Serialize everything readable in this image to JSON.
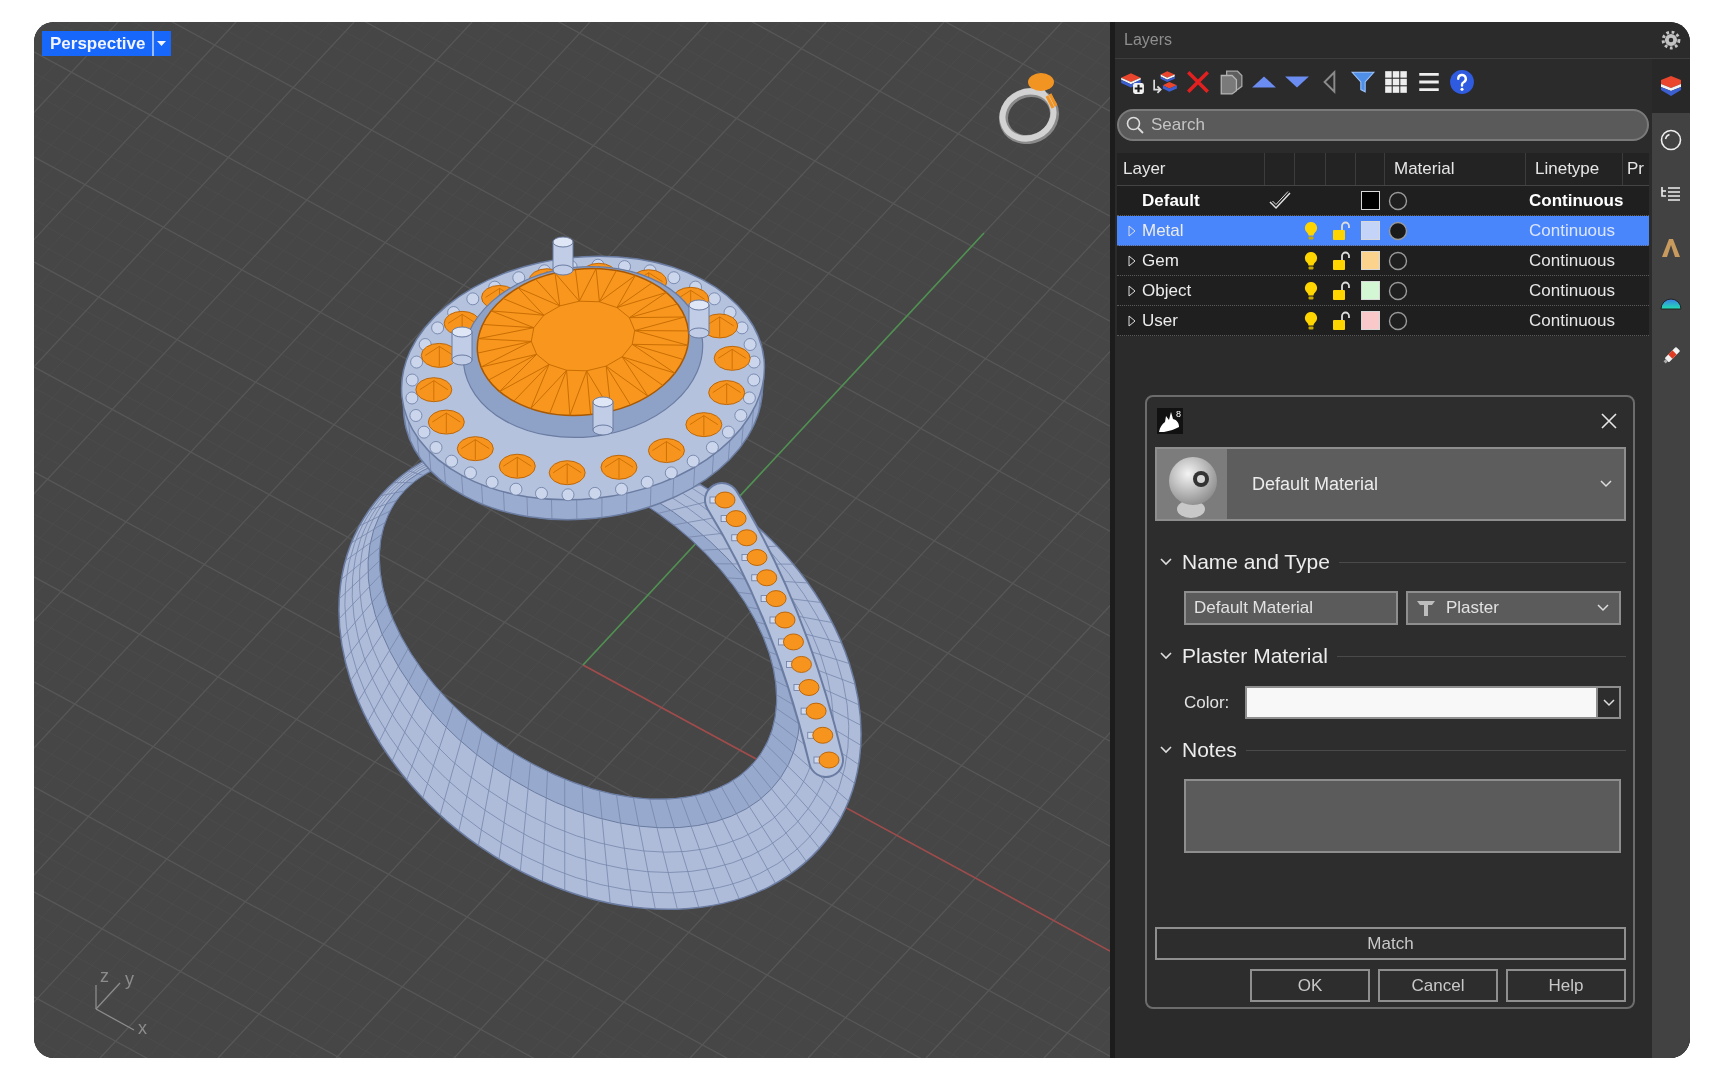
{
  "viewport": {
    "title": "Perspective",
    "axes": [
      {
        "label": "z"
      },
      {
        "label": "y"
      },
      {
        "label": "x"
      }
    ]
  },
  "layers_panel": {
    "title": "Layers",
    "search": {
      "placeholder": "Search"
    },
    "columns": [
      {
        "label": "Layer"
      },
      {
        "label": "Material"
      },
      {
        "label": "Linetype"
      },
      {
        "label": "Pr"
      }
    ],
    "rows": [
      {
        "name": "Default",
        "current": true,
        "expandable": false,
        "selected": false,
        "color": "#000000",
        "material_set": false,
        "linetype": "Continuous"
      },
      {
        "name": "Metal",
        "current": false,
        "expandable": true,
        "selected": true,
        "on": true,
        "locked": false,
        "color": "#c3d4f8",
        "material_set": true,
        "linetype": "Continuous"
      },
      {
        "name": "Gem",
        "current": false,
        "expandable": true,
        "selected": false,
        "on": true,
        "locked": false,
        "color": "#fcd38c",
        "material_set": false,
        "linetype": "Continuous"
      },
      {
        "name": "Object",
        "current": false,
        "expandable": true,
        "selected": false,
        "on": true,
        "locked": false,
        "color": "#d3f6d3",
        "material_set": false,
        "linetype": "Continuous"
      },
      {
        "name": "User",
        "current": false,
        "expandable": true,
        "selected": false,
        "on": true,
        "locked": false,
        "color": "#f9c9c9",
        "material_set": false,
        "linetype": "Continuous"
      }
    ]
  },
  "side_tabs": [
    {
      "selected": true
    },
    {
      "selected": false
    },
    {
      "selected": false
    },
    {
      "selected": false
    },
    {
      "selected": false
    },
    {
      "selected": false
    }
  ],
  "material_dialog": {
    "logo_text": "8",
    "preview_name": "Default Material",
    "sections": [
      {
        "kind": "name_type",
        "title": "Name and Type",
        "expanded": true,
        "name_value": "Default Material",
        "type_value": "Plaster"
      },
      {
        "kind": "color",
        "title": "Plaster Material",
        "expanded": true,
        "label": "Color:",
        "color": "#f8f8f8"
      },
      {
        "kind": "notes",
        "title": "Notes",
        "expanded": true
      }
    ],
    "match_button": "Match",
    "buttons": [
      "OK",
      "Cancel",
      "Help"
    ]
  }
}
